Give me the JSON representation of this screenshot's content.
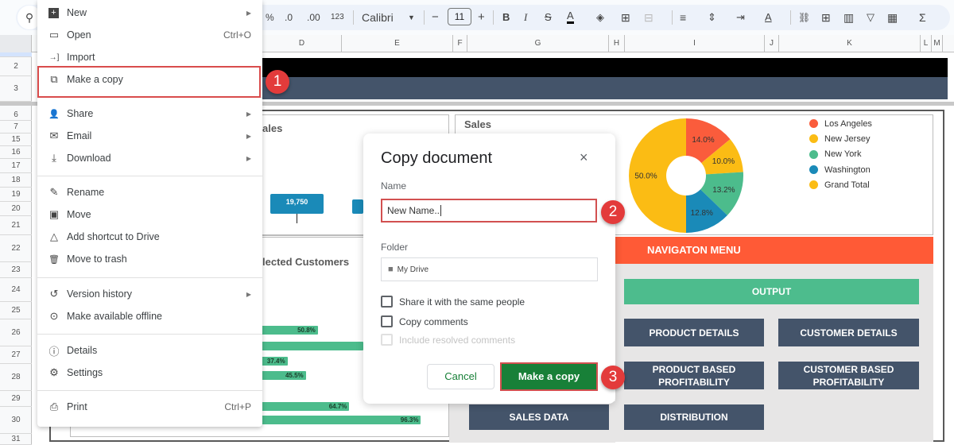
{
  "toolbar": {
    "percent": "%",
    "dec_decrease": ".0",
    "dec_increase": ".00",
    "num_format": "123",
    "font": "Calibri",
    "font_size": "11",
    "minus": "−",
    "plus": "+",
    "bold": "B",
    "italic": "I",
    "strike": "S",
    "text_color": "A",
    "fill": "◈",
    "borders": "⊞",
    "merge": "⊟",
    "align": "≡",
    "valign": "⇕",
    "wrap": "⇥",
    "rotate": "A",
    "link": "⛓",
    "comment": "⊞",
    "chart": "▥",
    "filter": "▽",
    "functions_view": "▦",
    "sum": "Σ"
  },
  "columns": [
    "D",
    "E",
    "F",
    "G",
    "H",
    "I",
    "J",
    "K",
    "L",
    "M"
  ],
  "rows": [
    "2",
    "3",
    "6",
    "7",
    "15",
    "16",
    "17",
    "18",
    "19",
    "20",
    "21",
    "22",
    "23",
    "24",
    "25",
    "26",
    "27",
    "28",
    "29",
    "30",
    "31"
  ],
  "file_menu": {
    "items": [
      {
        "label": "New",
        "icon": "+",
        "arrow": true
      },
      {
        "label": "Open",
        "icon": "▭",
        "shortcut": "Ctrl+O"
      },
      {
        "label": "Import",
        "icon": "→]"
      },
      {
        "label": "Make a copy",
        "icon": "⧉"
      },
      {
        "label": "Share",
        "icon": "👤"
      },
      {
        "label": "Email",
        "icon": "✉"
      },
      {
        "label": "Download",
        "icon": "⤓"
      },
      {
        "label": "Rename",
        "icon": "✎"
      },
      {
        "label": "Move",
        "icon": "▣"
      },
      {
        "label": "Add shortcut to Drive",
        "icon": "△"
      },
      {
        "label": "Move to trash",
        "icon": "🗑"
      },
      {
        "label": "Version history",
        "icon": "↺"
      },
      {
        "label": "Make available offline",
        "icon": "⊙"
      },
      {
        "label": "Details",
        "icon": "ⓘ"
      },
      {
        "label": "Settings",
        "icon": "⚙"
      },
      {
        "label": "Print",
        "icon": "⎙",
        "shortcut": "Ctrl+P"
      }
    ]
  },
  "steps": [
    "1",
    "2",
    "3"
  ],
  "dialog": {
    "title": "Copy document",
    "close": "×",
    "name_label": "Name",
    "name_value": "New Name..",
    "folder_label": "Folder",
    "folder_value": "My Drive",
    "share_label": "Share it with the same people",
    "copy_comments_label": "Copy comments",
    "include_resolved_label": "Include resolved comments",
    "cancel_label": "Cancel",
    "confirm_label": "Make a copy"
  },
  "dashboard": {
    "left_panel_title": "ales",
    "bar_chip_value": "19,750",
    "customers_title": "lected Customers",
    "customer_bars": [
      {
        "label": "50.8%",
        "value": 50.8
      },
      {
        "label": "",
        "value": 100
      },
      {
        "label": "37.4%",
        "value": 37.4
      },
      {
        "label": "45.5%",
        "value": 45.5
      },
      {
        "label": "64.7%",
        "value": 64.7
      },
      {
        "label": "96.3%",
        "value": 96.3
      }
    ],
    "sales_panel_title": "Sales",
    "pie": {
      "slices": [
        {
          "name": "Los Angeles",
          "label": "14.0%",
          "value": 14.0,
          "color": "#fa5c3c"
        },
        {
          "name": "New Jersey",
          "label": "10.0%",
          "value": 10.0,
          "color": "#fbbc14"
        },
        {
          "name": "New York",
          "label": "13.2%",
          "value": 13.2,
          "color": "#4cbc8c"
        },
        {
          "name": "Washington",
          "label": "12.8%",
          "value": 12.8,
          "color": "#1a8ab8"
        },
        {
          "name": "Grand Total",
          "label": "50.0%",
          "value": 50.0,
          "color": "#fbbc14"
        }
      ]
    },
    "nav": {
      "title": "NAVIGATON MENU",
      "output": "OUTPUT",
      "product_details": "PRODUCT DETAILS",
      "customer_details": "CUSTOMER DETAILS",
      "product_profit": "PRODUCT BASED PROFITABILITY",
      "customer_profit": "CUSTOMER BASED PROFITABILITY",
      "sales_data": "SALES DATA",
      "distribution": "DISTRIBUTION"
    }
  },
  "colors": {
    "accent_green": "#188038",
    "highlight_red": "#d94c4c",
    "nav_orange": "#ff5a36",
    "nav_slate": "#44546a",
    "nav_green": "#4dbc8d"
  }
}
